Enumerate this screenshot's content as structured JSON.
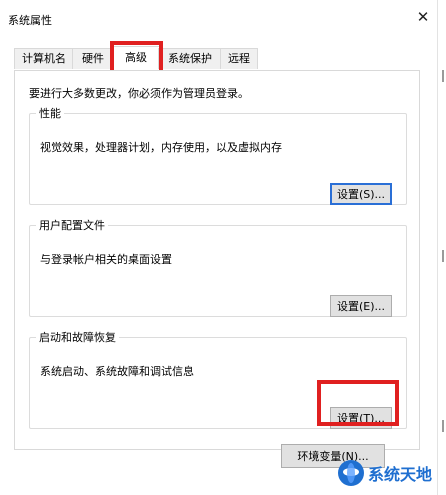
{
  "window": {
    "title": "系统属性"
  },
  "tabs": [
    {
      "label": "计算机名",
      "active": false
    },
    {
      "label": "硬件",
      "active": false
    },
    {
      "label": "高级",
      "active": true
    },
    {
      "label": "系统保护",
      "active": false
    },
    {
      "label": "远程",
      "active": false
    }
  ],
  "notice": "要进行大多数更改，你必须作为管理员登录。",
  "performance": {
    "legend": "性能",
    "description": "视觉效果，处理器计划，内存使用，以及虚拟内存",
    "button_label": "设置(S)..."
  },
  "user_profiles": {
    "legend": "用户配置文件",
    "description": "与登录帐户相关的桌面设置",
    "button_label": "设置(E)..."
  },
  "startup_recovery": {
    "legend": "启动和故障恢复",
    "description": "系统启动、系统故障和调试信息",
    "button_label": "设置(T)..."
  },
  "env_button_label": "环境变量(N)...",
  "watermark": {
    "text": "系统天地"
  },
  "colors": {
    "highlight_box": "#e02020",
    "focus_border": "#2a6fd6",
    "watermark": "#1f6fd0"
  }
}
